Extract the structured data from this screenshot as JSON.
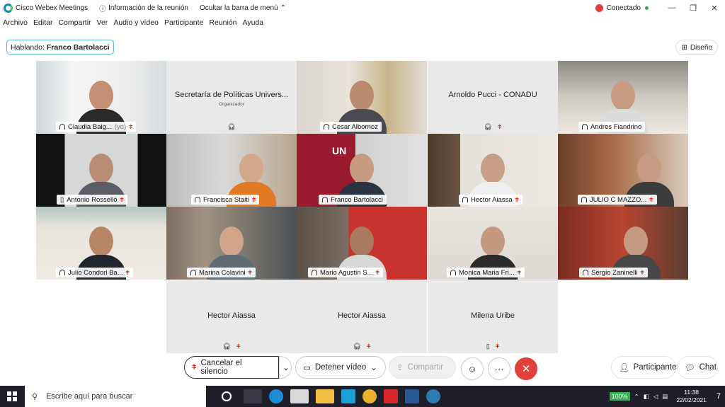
{
  "titlebar": {
    "app_name": "Cisco Webex Meetings",
    "meeting_info": "Información de la reunión",
    "hide_menu": "Ocultar la barra de menú",
    "status": "Conectado"
  },
  "menu": [
    "Archivo",
    "Editar",
    "Compartir",
    "Ver",
    "Audio y vídeo",
    "Participante",
    "Reunión",
    "Ayuda"
  ],
  "speaking": {
    "label": "Hablando:",
    "name": "Franco Bartolacci"
  },
  "layout_button": "Diseño",
  "tiles": [
    {
      "name": "Claudia Baig...",
      "suffix": "(yo)",
      "type": "video",
      "muted": true
    },
    {
      "name": "Secretaría de Políticas Univers...",
      "subtitle": "Organizador",
      "type": "avatar",
      "muted": false
    },
    {
      "name": "Cesar Albornoz",
      "type": "video",
      "muted": false
    },
    {
      "name": "Arnoldo Pucci - CONADU",
      "type": "avatar",
      "muted": true
    },
    {
      "name": "Andres Fiandrino",
      "type": "video",
      "muted": false
    },
    {
      "name": "Antonio Rosselló",
      "type": "video",
      "muted": true
    },
    {
      "name": "Francisca Staiti",
      "type": "video",
      "muted": true
    },
    {
      "name": "Franco Bartolacci",
      "type": "video",
      "muted": false,
      "active": true
    },
    {
      "name": "Hector Aiassa",
      "type": "video",
      "muted": true
    },
    {
      "name": "JULIO C MAZZO...",
      "type": "video",
      "muted": true
    },
    {
      "name": "Julio Condori Ba...",
      "type": "video",
      "muted": true
    },
    {
      "name": "Marina Colavini",
      "type": "video",
      "muted": true
    },
    {
      "name": "Mario Agustin S...",
      "type": "video",
      "muted": true
    },
    {
      "name": "Monica Maria Fri...",
      "type": "video",
      "muted": true
    },
    {
      "name": "Sergio Zaninelli",
      "type": "video",
      "muted": true
    },
    {
      "name": "Hector Aiassa",
      "type": "avatar",
      "muted": true
    },
    {
      "name": "Hector Aiassa",
      "type": "avatar",
      "muted": true
    },
    {
      "name": "Milena Uribe",
      "type": "avatar",
      "muted": true
    }
  ],
  "controls": {
    "unmute": "Cancelar el silencio",
    "stop_video": "Detener vídeo",
    "share": "Compartir",
    "participants": "Participantes",
    "chat": "Chat"
  },
  "taskbar": {
    "search_placeholder": "Escribe aquí para buscar",
    "battery": "100%",
    "time": "11:38",
    "date": "22/02/2021",
    "notifications": "7"
  },
  "colors": {
    "accent": "#19a1de",
    "end": "#e2413b",
    "mute_red": "#e0352b"
  }
}
